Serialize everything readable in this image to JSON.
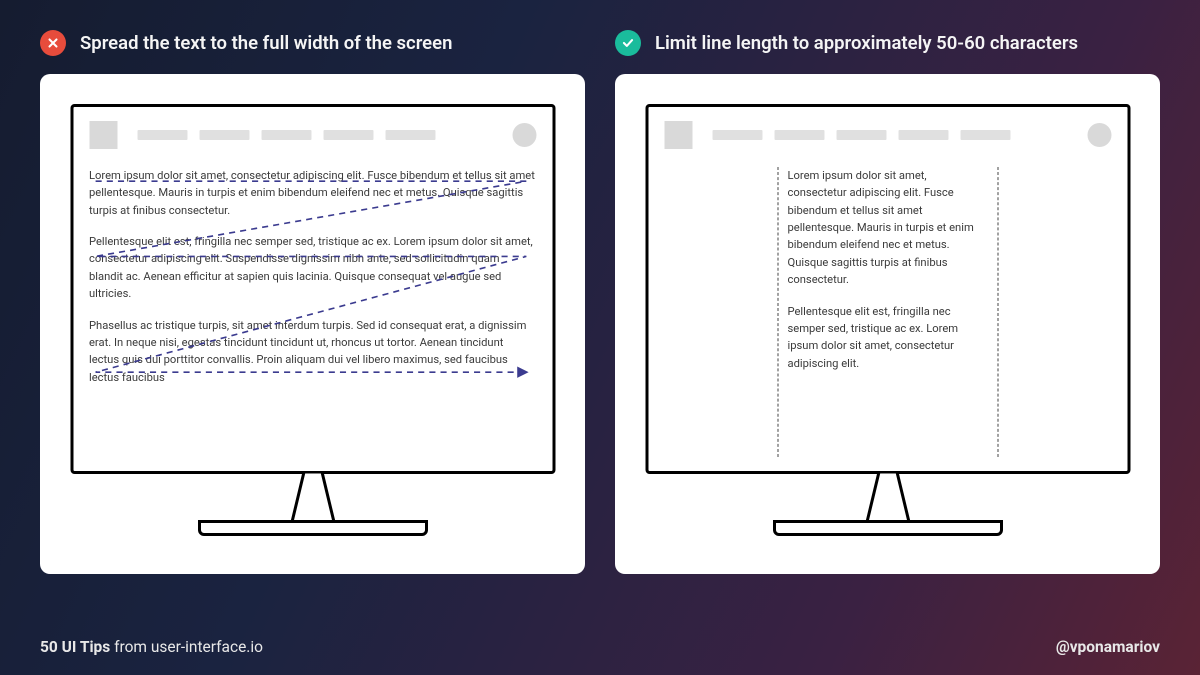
{
  "bad": {
    "heading": "Spread the text to the full width of the screen",
    "para1": "Lorem ipsum dolor sit amet, consectetur adipiscing elit. Fusce bibendum et tellus sit amet pellentesque. Mauris in turpis et enim bibendum eleifend nec et metus. Quisque sagittis turpis at finibus consectetur.",
    "para2": "Pellentesque elit est, fringilla nec semper sed, tristique ac ex. Lorem ipsum dolor sit amet, consectetur adipiscing elit. Suspendisse dignissim nibh ante, sed sollicitudin quam blandit ac. Aenean efficitur at sapien quis lacinia. Quisque consequat vel augue sed ultricies.",
    "para3": "Phasellus ac tristique turpis, sit amet interdum turpis. Sed id consequat erat, a dignissim erat. In neque nisi, egestas tincidunt tincidunt ut, rhoncus ut tortor. Aenean tincidunt lectus quis dui porttitor convallis. Proin aliquam dui vel libero maximus, sed faucibus lectus faucibus"
  },
  "good": {
    "heading": "Limit line length to approximately 50-60 characters",
    "para1": "Lorem ipsum dolor sit amet, consectetur adipiscing elit. Fusce bibendum et tellus sit amet pellentesque. Mauris in turpis et enim bibendum eleifend nec et metus. Quisque sagittis turpis at finibus consectetur.",
    "para2": "Pellentesque elit est, fringilla nec semper sed, tristique ac ex. Lorem ipsum dolor sit amet, consectetur adipiscing elit."
  },
  "footer": {
    "series": "50 UI Tips",
    "from": " from user-interface.io",
    "handle": "@vponamariov"
  },
  "colors": {
    "bad": "#e74c3c",
    "good": "#1abc9c",
    "eyepath": "#3b3b8f"
  }
}
